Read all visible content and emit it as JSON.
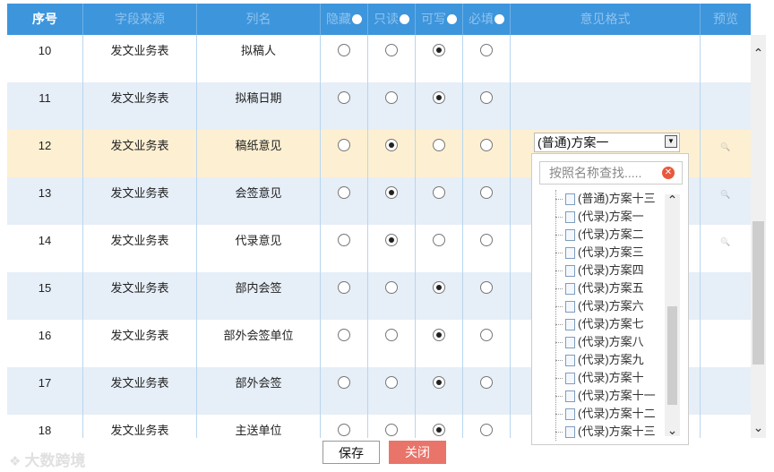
{
  "header": {
    "seq": "序号",
    "field_source": "字段来源",
    "column_name": "列名",
    "hidden": "隐藏",
    "readonly": "只读",
    "writable": "可写",
    "required": "必填",
    "opinion_format": "意见格式",
    "preview": "预览"
  },
  "rows": [
    {
      "num": "10",
      "source": "发文业务表",
      "col": "拟稿人",
      "sel": 2
    },
    {
      "num": "11",
      "source": "发文业务表",
      "col": "拟稿日期",
      "sel": 2
    },
    {
      "num": "12",
      "source": "发文业务表",
      "col": "稿纸意见",
      "sel": 1
    },
    {
      "num": "13",
      "source": "发文业务表",
      "col": "会签意见",
      "sel": 1
    },
    {
      "num": "14",
      "source": "发文业务表",
      "col": "代录意见",
      "sel": 1
    },
    {
      "num": "15",
      "source": "发文业务表",
      "col": "部内会签",
      "sel": 2
    },
    {
      "num": "16",
      "source": "发文业务表",
      "col": "部外会签单位",
      "sel": 2
    },
    {
      "num": "17",
      "source": "发文业务表",
      "col": "部外会签",
      "sel": 2
    },
    {
      "num": "18",
      "source": "发文业务表",
      "col": "主送单位",
      "sel": 2
    }
  ],
  "combo": {
    "value": "(普通)方案一"
  },
  "dropdown": {
    "search_placeholder": "按照名称查找.....",
    "items": [
      "(普通)方案十三",
      "(代录)方案一",
      "(代录)方案二",
      "(代录)方案三",
      "(代录)方案四",
      "(代录)方案五",
      "(代录)方案六",
      "(代录)方案七",
      "(代录)方案八",
      "(代录)方案九",
      "(代录)方案十",
      "(代录)方案十一",
      "(代录)方案十二",
      "(代录)方案十三"
    ]
  },
  "buttons": {
    "save": "保存",
    "close": "关闭"
  },
  "watermark": "大数跨境",
  "colors": {
    "header_bg": "#3d95dc",
    "highlight_row": "#fdf0d2",
    "close_button": "#e9746a"
  }
}
